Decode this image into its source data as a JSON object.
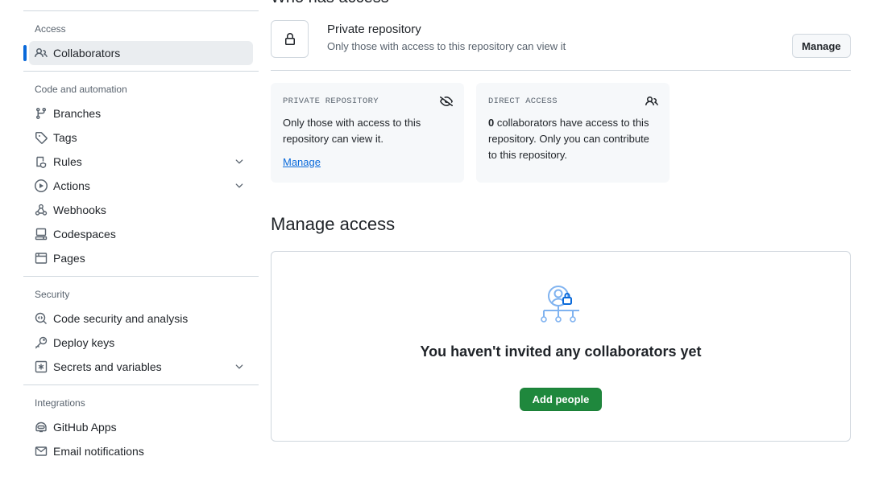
{
  "sidebar": {
    "sections": [
      {
        "title": "Access",
        "items": [
          {
            "label": "Collaborators",
            "icon": "people-icon",
            "active": true
          }
        ]
      },
      {
        "title": "Code and automation",
        "items": [
          {
            "label": "Branches",
            "icon": "git-branch-icon"
          },
          {
            "label": "Tags",
            "icon": "tag-icon"
          },
          {
            "label": "Rules",
            "icon": "rules-icon",
            "expandable": true
          },
          {
            "label": "Actions",
            "icon": "play-icon",
            "expandable": true
          },
          {
            "label": "Webhooks",
            "icon": "webhook-icon"
          },
          {
            "label": "Codespaces",
            "icon": "codespaces-icon"
          },
          {
            "label": "Pages",
            "icon": "browser-icon"
          }
        ]
      },
      {
        "title": "Security",
        "items": [
          {
            "label": "Code security and analysis",
            "icon": "codescan-icon"
          },
          {
            "label": "Deploy keys",
            "icon": "key-icon"
          },
          {
            "label": "Secrets and variables",
            "icon": "asterisk-icon",
            "expandable": true
          }
        ]
      },
      {
        "title": "Integrations",
        "items": [
          {
            "label": "GitHub Apps",
            "icon": "hubot-icon"
          },
          {
            "label": "Email notifications",
            "icon": "mail-icon"
          }
        ]
      }
    ]
  },
  "main": {
    "who_title": "Who has access",
    "repo_title": "Private repository",
    "repo_subtitle": "Only those with access to this repository can view it",
    "manage_label": "Manage",
    "cards": {
      "private": {
        "label": "PRIVATE REPOSITORY",
        "body": "Only those with access to this repository can view it.",
        "link": "Manage"
      },
      "direct": {
        "label": "DIRECT ACCESS",
        "count": "0",
        "body": " collaborators have access to this repository. Only you can contribute to this repository."
      }
    },
    "manage_access_title": "Manage access",
    "empty_text": "You haven't invited any collaborators yet",
    "add_people_label": "Add people"
  },
  "colors": {
    "accent": "#0969da",
    "primary_button": "#1f883d",
    "border": "#d0d7de",
    "card_bg": "#f6f8fa"
  }
}
